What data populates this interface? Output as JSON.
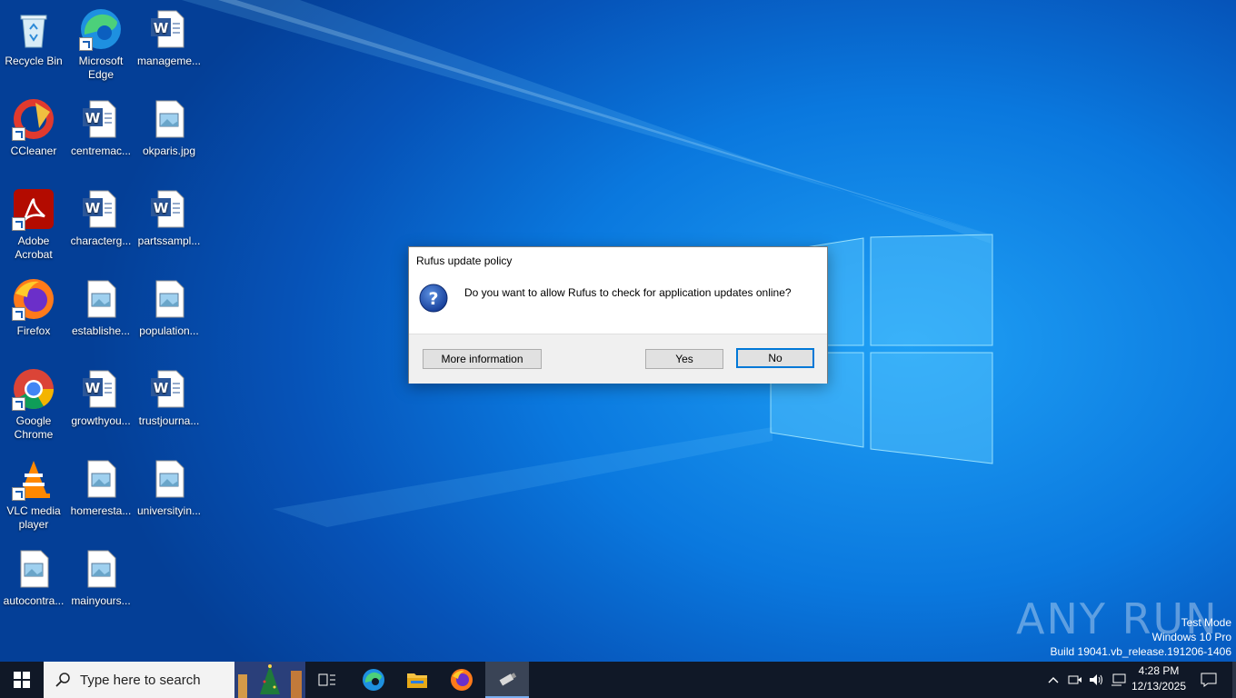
{
  "desktop_icons": [
    {
      "label": "Recycle Bin",
      "icon": "recycle-bin-icon"
    },
    {
      "label": "Microsoft Edge",
      "icon": "edge-icon"
    },
    {
      "label": "manageme...",
      "icon": "word-doc-icon"
    },
    {
      "label": "CCleaner",
      "icon": "ccleaner-icon"
    },
    {
      "label": "centremac...",
      "icon": "word-doc-icon"
    },
    {
      "label": "okparis.jpg",
      "icon": "image-file-icon"
    },
    {
      "label": "Adobe Acrobat",
      "icon": "acrobat-icon"
    },
    {
      "label": "characterg...",
      "icon": "word-doc-icon"
    },
    {
      "label": "partssampl...",
      "icon": "word-doc-icon"
    },
    {
      "label": "Firefox",
      "icon": "firefox-icon"
    },
    {
      "label": "establishe...",
      "icon": "image-file-icon"
    },
    {
      "label": "population...",
      "icon": "image-file-icon"
    },
    {
      "label": "Google Chrome",
      "icon": "chrome-icon"
    },
    {
      "label": "growthyou...",
      "icon": "word-doc-icon"
    },
    {
      "label": "trustjourna...",
      "icon": "word-doc-icon"
    },
    {
      "label": "VLC media player",
      "icon": "vlc-icon"
    },
    {
      "label": "homeresta...",
      "icon": "image-file-icon"
    },
    {
      "label": "universityin...",
      "icon": "image-file-icon"
    },
    {
      "label": "autocontra...",
      "icon": "image-file-icon"
    },
    {
      "label": "mainyours...",
      "icon": "image-file-icon"
    }
  ],
  "dialog": {
    "title": "Rufus update policy",
    "message": "Do you want to allow Rufus to check for application updates online?",
    "more_info_label": "More information",
    "yes_label": "Yes",
    "no_label": "No"
  },
  "taskbar": {
    "search_placeholder": "Type here to search",
    "time": "4:28 PM",
    "date": "12/13/2025"
  },
  "watermark": {
    "line1": "Test Mode",
    "line2": "Windows 10 Pro",
    "line3": "Build 19041.vb_release.191206-1406",
    "brand": "ANY RUN"
  },
  "colors": {
    "accent": "#0078d7",
    "taskbar": "#101827"
  }
}
